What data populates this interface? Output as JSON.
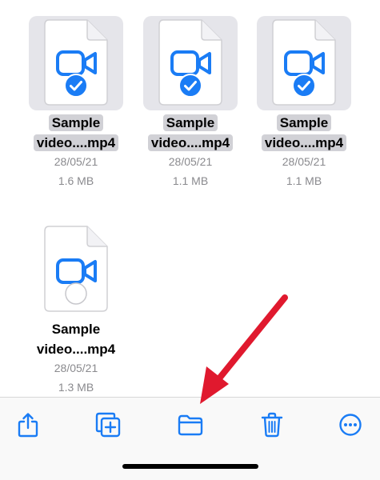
{
  "files": [
    {
      "name_line1": "Sample",
      "name_line2": "video....mp4",
      "date": "28/05/21",
      "size": "1.6 MB",
      "selected": true,
      "icon": "video-camera-icon"
    },
    {
      "name_line1": "Sample",
      "name_line2": "video....mp4",
      "date": "28/05/21",
      "size": "1.1 MB",
      "selected": true,
      "icon": "video-camera-icon"
    },
    {
      "name_line1": "Sample",
      "name_line2": "video....mp4",
      "date": "28/05/21",
      "size": "1.1 MB",
      "selected": true,
      "icon": "video-camera-icon"
    },
    {
      "name_line1": "Sample",
      "name_line2": "video....mp4",
      "date": "28/05/21",
      "size": "1.3 MB",
      "selected": false,
      "icon": "video-camera-icon"
    }
  ],
  "toolbar": {
    "items": [
      "share-icon",
      "duplicate-icon",
      "move-folder-icon",
      "trash-icon",
      "more-icon"
    ]
  },
  "colors": {
    "accent": "#1a7cf5",
    "annotation_arrow": "#e0192e",
    "selection_bg": "#e5e5ea"
  }
}
